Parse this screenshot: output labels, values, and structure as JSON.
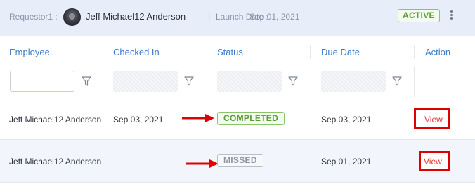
{
  "header": {
    "requestor_label": "Requestor1 :",
    "requestor_name": "Jeff Michael12 Anderson",
    "separator": "|",
    "launch_label": "Launch Date :",
    "launch_value": "Sep 01, 2021",
    "status": "ACTIVE",
    "icons": {
      "avatar": "user-avatar",
      "menu": "kebab-menu-icon"
    }
  },
  "table": {
    "columns": [
      "Employee",
      "Checked In",
      "Status",
      "Due Date",
      "Action"
    ],
    "filter_icon": "funnel-filter-icon",
    "rows": [
      {
        "employee": "Jeff Michael12 Anderson",
        "checked_in": "Sep 03, 2021",
        "status": "COMPLETED",
        "due_date": "Sep 03, 2021",
        "action": "View"
      },
      {
        "employee": "Jeff Michael12 Anderson",
        "checked_in": "",
        "status": "MISSED",
        "due_date": "Sep 01, 2021",
        "action": "View"
      }
    ]
  },
  "colors": {
    "header_bg": "#e8eef9",
    "column_header_text": "#3b7bc8",
    "active_green": "#5a9d33",
    "missed_gray": "#8e95a3",
    "annotation_red": "#e10000",
    "link_red": "#e23636"
  }
}
